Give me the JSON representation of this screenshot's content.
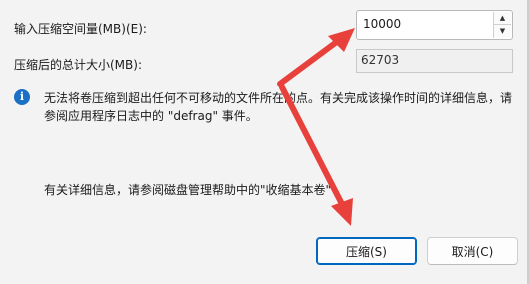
{
  "dialog": {
    "shrink_amount_label": "输入压缩空间量(MB)(E):",
    "shrink_amount_value": "10000",
    "total_size_after_label": "压缩后的总计大小(MB):",
    "total_size_after_value": "62703",
    "info_text": "无法将卷压缩到超出任何不可移动的文件所在的点。有关完成该操作时间的详细信息，请参阅应用程序日志中的 \"defrag\" 事件。",
    "help_text": "有关详细信息，请参阅磁盘管理帮助中的\"收缩基本卷\"",
    "shrink_button_label": "压缩(S)",
    "cancel_button_label": "取消(C)"
  },
  "icons": {
    "info": "info-icon",
    "spinner_up": "chevron-up-icon",
    "spinner_down": "chevron-down-icon"
  },
  "colors": {
    "annotation_arrow": "#e8413b",
    "info_icon": "#1b6fc4",
    "primary_border": "#0067c0"
  }
}
